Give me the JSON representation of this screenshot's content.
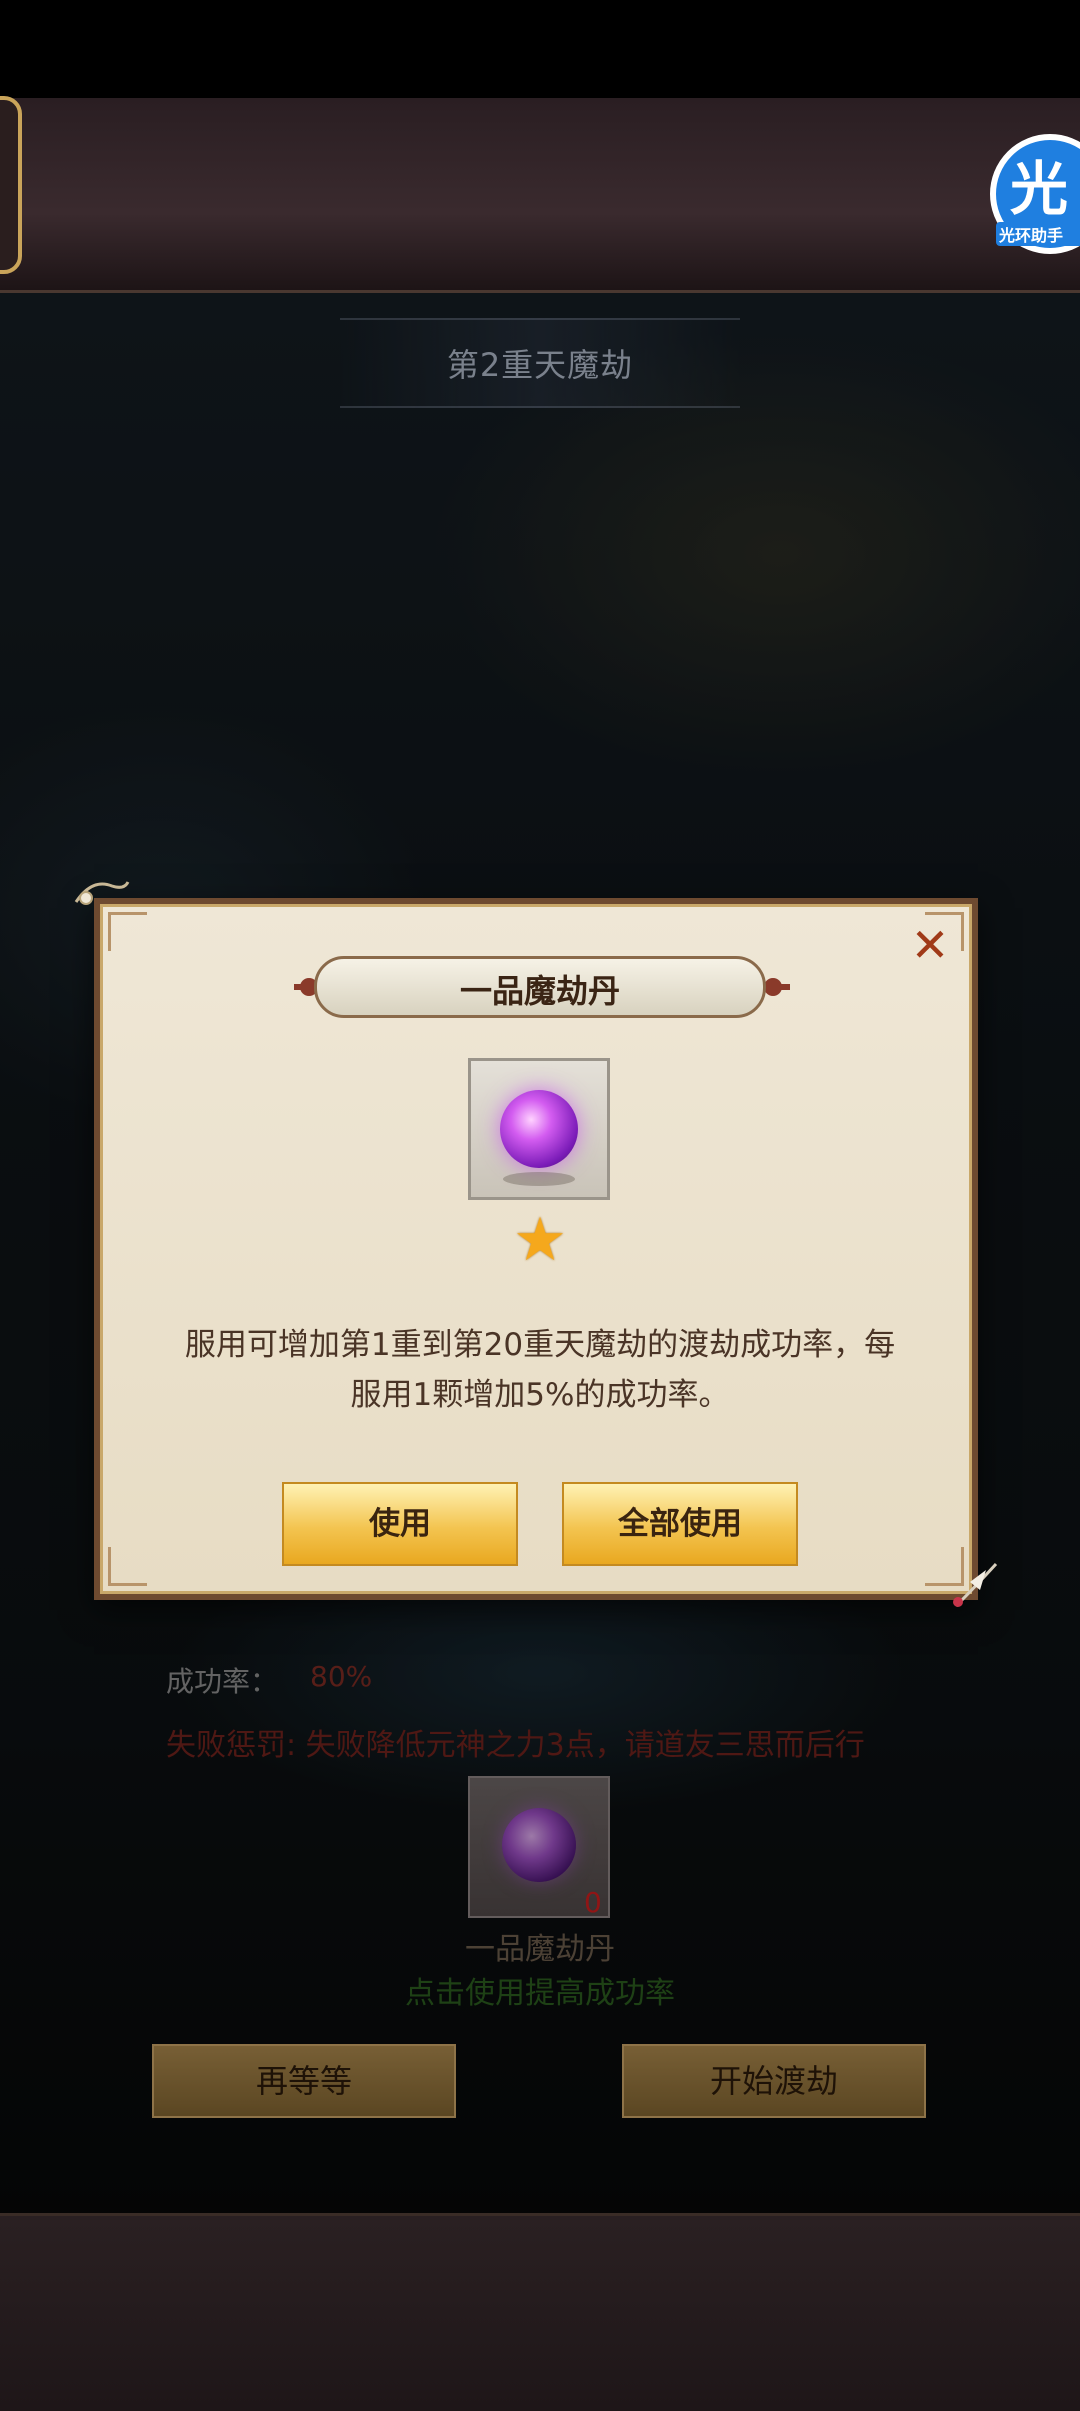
{
  "stage": {
    "title": "第2重天魔劫"
  },
  "badge": {
    "char": "光",
    "label": "光环助手"
  },
  "modal": {
    "item_title": "一品魔劫丹",
    "description_line1": "服用可增加第1重到第20重天魔劫的渡劫成功率，每",
    "description_line2": "服用1颗增加5%的成功率。",
    "use_label": "使用",
    "use_all_label": "全部使用",
    "stars": 1
  },
  "page": {
    "rate_label": "成功率：",
    "rate_value": "80%",
    "penalty": "失败惩罚: 失败降低元神之力3点，请道友三思而后行",
    "item_name": "一品魔劫丹",
    "item_count": "0",
    "item_hint": "点击使用提高成功率",
    "wait_label": "再等等",
    "start_label": "开始渡劫"
  },
  "colors": {
    "accent_gold": "#f3c450",
    "modal_bg": "#efe7d6",
    "close_red": "#a03a18",
    "penalty_red": "#6e221c",
    "hint_green": "#2a5a1e"
  }
}
